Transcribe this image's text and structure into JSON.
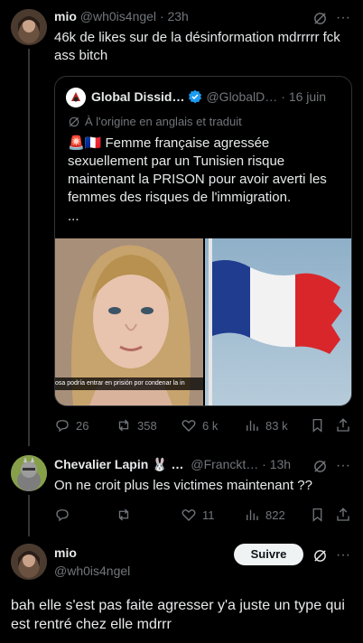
{
  "tweet1": {
    "name": "mio",
    "handle": "@wh0is4ngel",
    "time": "· 23h",
    "text": "46k de likes sur de la désinformation mdrrrrr fck ass bitch",
    "quote": {
      "name": "Global Dissid…",
      "handle": "@GlobalD…",
      "time": "· 16 juin",
      "translated": "À l'origine en anglais et traduit",
      "text": "🚨🇫🇷 Femme française agressée sexuellement par un Tunisien risque maintenant la PRISON pour avoir averti les femmes des risques de l'immigration.",
      "more": "...",
      "caption": "osa podría entrar en prisión por condenar la in"
    },
    "stats": {
      "replies": "26",
      "retweets": "358",
      "likes": "6 k",
      "views": "83 k"
    }
  },
  "tweet2": {
    "name": "Chevalier Lapin 🐰 …",
    "handle": "@Franckt…",
    "time": "· 13h",
    "text": "On ne croit plus les victimes maintenant ??",
    "stats": {
      "replies": "",
      "retweets": "",
      "likes": "11",
      "views": "822"
    }
  },
  "tweet3": {
    "name": "mio",
    "handle": "@wh0is4ngel",
    "follow_label": "Suivre",
    "text": "bah elle s'est pas faite agresser y'a juste un type qui est rentré chez elle mdrrr"
  },
  "colors": {
    "bg": "#000000",
    "text": "#e7e9ea",
    "muted": "#71767b",
    "verified": "#1d9bf0",
    "line": "#333639"
  }
}
